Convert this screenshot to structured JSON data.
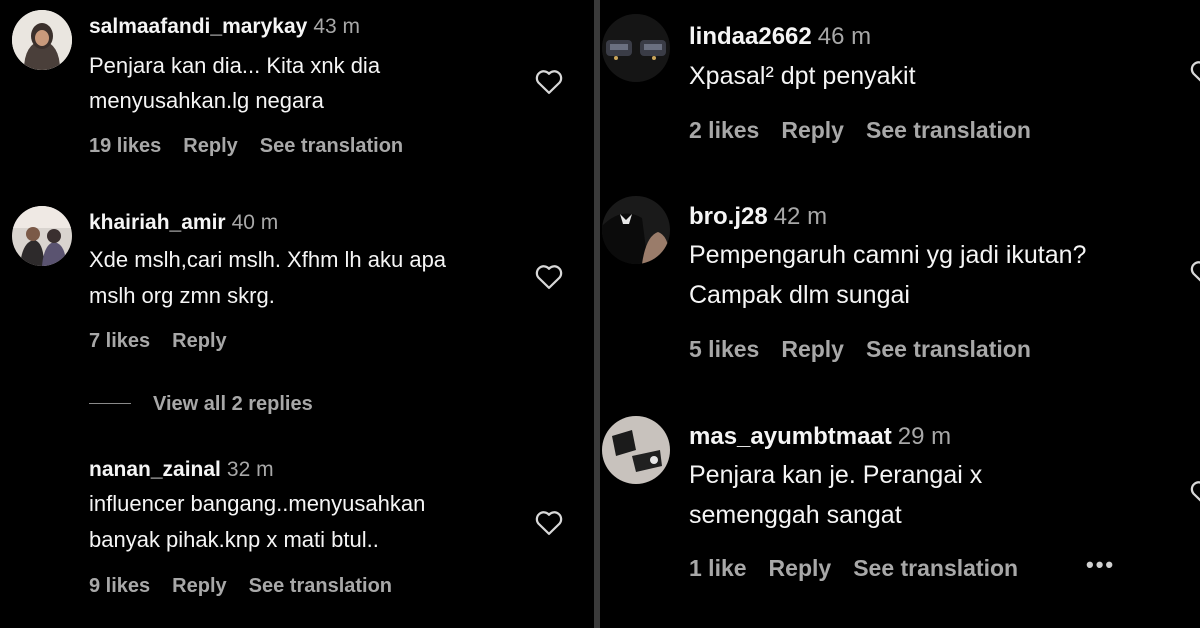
{
  "left_comments": [
    {
      "username": "salmaafandi_marykay",
      "time": "43 m",
      "lines": [
        "Penjara kan dia... Kita xnk dia",
        "menyusahkan.lg negara"
      ],
      "likes": "19 likes",
      "reply": "Reply",
      "translate": "See translation"
    },
    {
      "username": "khairiah_amir",
      "time": "40 m",
      "lines": [
        "Xde mslh,cari mslh. Xfhm lh aku apa",
        "mslh org zmn skrg."
      ],
      "likes": "7 likes",
      "reply": "Reply",
      "translate": ""
    },
    {
      "username": "nanan_zainal",
      "time": "32 m",
      "lines": [
        "influencer bangang..menyusahkan",
        "banyak pihak.knp x mati btul.."
      ],
      "likes": "9 likes",
      "reply": "Reply",
      "translate": "See translation"
    }
  ],
  "view_replies": "View all 2 replies",
  "right_comments": [
    {
      "username": "lindaa2662",
      "time": "46 m",
      "lines": [
        "Xpasal² dpt penyakit"
      ],
      "likes": "2 likes",
      "reply": "Reply",
      "translate": "See translation"
    },
    {
      "username": "bro.j28",
      "time": "42 m",
      "lines": [
        "Pempengaruh camni yg jadi ikutan?",
        "Campak dlm sungai"
      ],
      "likes": "5 likes",
      "reply": "Reply",
      "translate": "See translation"
    },
    {
      "username": "mas_ayumbtmaat",
      "time": "29 m",
      "lines": [
        "Penjara kan je. Perangai x",
        "semenggah sangat"
      ],
      "likes": "1 like",
      "reply": "Reply",
      "translate": "See translation"
    }
  ],
  "more_label": "•••",
  "icons": {
    "like": "heart-outline-icon",
    "more": "more-options-icon"
  }
}
